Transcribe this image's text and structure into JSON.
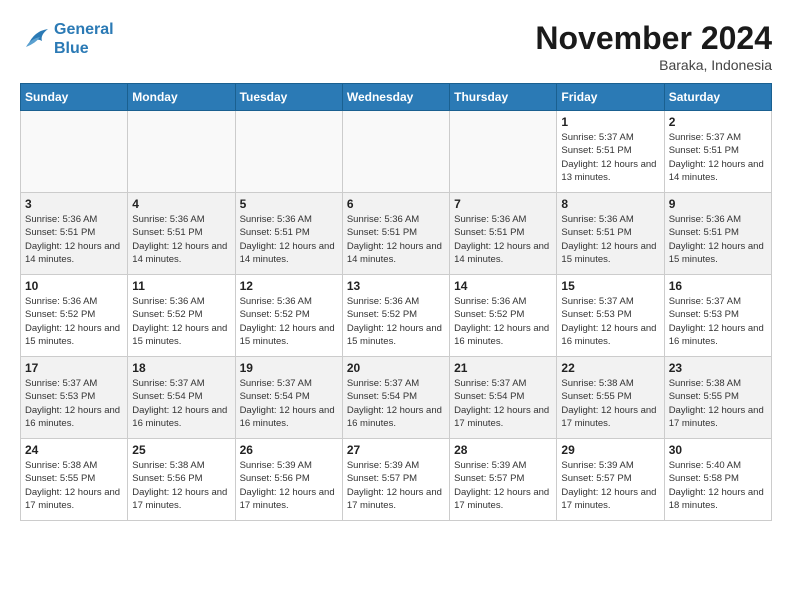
{
  "logo": {
    "line1": "General",
    "line2": "Blue"
  },
  "title": "November 2024",
  "location": "Baraka, Indonesia",
  "weekdays": [
    "Sunday",
    "Monday",
    "Tuesday",
    "Wednesday",
    "Thursday",
    "Friday",
    "Saturday"
  ],
  "weeks": [
    [
      {
        "day": "",
        "sunrise": "",
        "sunset": "",
        "daylight": ""
      },
      {
        "day": "",
        "sunrise": "",
        "sunset": "",
        "daylight": ""
      },
      {
        "day": "",
        "sunrise": "",
        "sunset": "",
        "daylight": ""
      },
      {
        "day": "",
        "sunrise": "",
        "sunset": "",
        "daylight": ""
      },
      {
        "day": "",
        "sunrise": "",
        "sunset": "",
        "daylight": ""
      },
      {
        "day": "1",
        "sunrise": "Sunrise: 5:37 AM",
        "sunset": "Sunset: 5:51 PM",
        "daylight": "Daylight: 12 hours and 13 minutes."
      },
      {
        "day": "2",
        "sunrise": "Sunrise: 5:37 AM",
        "sunset": "Sunset: 5:51 PM",
        "daylight": "Daylight: 12 hours and 14 minutes."
      }
    ],
    [
      {
        "day": "3",
        "sunrise": "Sunrise: 5:36 AM",
        "sunset": "Sunset: 5:51 PM",
        "daylight": "Daylight: 12 hours and 14 minutes."
      },
      {
        "day": "4",
        "sunrise": "Sunrise: 5:36 AM",
        "sunset": "Sunset: 5:51 PM",
        "daylight": "Daylight: 12 hours and 14 minutes."
      },
      {
        "day": "5",
        "sunrise": "Sunrise: 5:36 AM",
        "sunset": "Sunset: 5:51 PM",
        "daylight": "Daylight: 12 hours and 14 minutes."
      },
      {
        "day": "6",
        "sunrise": "Sunrise: 5:36 AM",
        "sunset": "Sunset: 5:51 PM",
        "daylight": "Daylight: 12 hours and 14 minutes."
      },
      {
        "day": "7",
        "sunrise": "Sunrise: 5:36 AM",
        "sunset": "Sunset: 5:51 PM",
        "daylight": "Daylight: 12 hours and 14 minutes."
      },
      {
        "day": "8",
        "sunrise": "Sunrise: 5:36 AM",
        "sunset": "Sunset: 5:51 PM",
        "daylight": "Daylight: 12 hours and 15 minutes."
      },
      {
        "day": "9",
        "sunrise": "Sunrise: 5:36 AM",
        "sunset": "Sunset: 5:51 PM",
        "daylight": "Daylight: 12 hours and 15 minutes."
      }
    ],
    [
      {
        "day": "10",
        "sunrise": "Sunrise: 5:36 AM",
        "sunset": "Sunset: 5:52 PM",
        "daylight": "Daylight: 12 hours and 15 minutes."
      },
      {
        "day": "11",
        "sunrise": "Sunrise: 5:36 AM",
        "sunset": "Sunset: 5:52 PM",
        "daylight": "Daylight: 12 hours and 15 minutes."
      },
      {
        "day": "12",
        "sunrise": "Sunrise: 5:36 AM",
        "sunset": "Sunset: 5:52 PM",
        "daylight": "Daylight: 12 hours and 15 minutes."
      },
      {
        "day": "13",
        "sunrise": "Sunrise: 5:36 AM",
        "sunset": "Sunset: 5:52 PM",
        "daylight": "Daylight: 12 hours and 15 minutes."
      },
      {
        "day": "14",
        "sunrise": "Sunrise: 5:36 AM",
        "sunset": "Sunset: 5:52 PM",
        "daylight": "Daylight: 12 hours and 16 minutes."
      },
      {
        "day": "15",
        "sunrise": "Sunrise: 5:37 AM",
        "sunset": "Sunset: 5:53 PM",
        "daylight": "Daylight: 12 hours and 16 minutes."
      },
      {
        "day": "16",
        "sunrise": "Sunrise: 5:37 AM",
        "sunset": "Sunset: 5:53 PM",
        "daylight": "Daylight: 12 hours and 16 minutes."
      }
    ],
    [
      {
        "day": "17",
        "sunrise": "Sunrise: 5:37 AM",
        "sunset": "Sunset: 5:53 PM",
        "daylight": "Daylight: 12 hours and 16 minutes."
      },
      {
        "day": "18",
        "sunrise": "Sunrise: 5:37 AM",
        "sunset": "Sunset: 5:54 PM",
        "daylight": "Daylight: 12 hours and 16 minutes."
      },
      {
        "day": "19",
        "sunrise": "Sunrise: 5:37 AM",
        "sunset": "Sunset: 5:54 PM",
        "daylight": "Daylight: 12 hours and 16 minutes."
      },
      {
        "day": "20",
        "sunrise": "Sunrise: 5:37 AM",
        "sunset": "Sunset: 5:54 PM",
        "daylight": "Daylight: 12 hours and 16 minutes."
      },
      {
        "day": "21",
        "sunrise": "Sunrise: 5:37 AM",
        "sunset": "Sunset: 5:54 PM",
        "daylight": "Daylight: 12 hours and 17 minutes."
      },
      {
        "day": "22",
        "sunrise": "Sunrise: 5:38 AM",
        "sunset": "Sunset: 5:55 PM",
        "daylight": "Daylight: 12 hours and 17 minutes."
      },
      {
        "day": "23",
        "sunrise": "Sunrise: 5:38 AM",
        "sunset": "Sunset: 5:55 PM",
        "daylight": "Daylight: 12 hours and 17 minutes."
      }
    ],
    [
      {
        "day": "24",
        "sunrise": "Sunrise: 5:38 AM",
        "sunset": "Sunset: 5:55 PM",
        "daylight": "Daylight: 12 hours and 17 minutes."
      },
      {
        "day": "25",
        "sunrise": "Sunrise: 5:38 AM",
        "sunset": "Sunset: 5:56 PM",
        "daylight": "Daylight: 12 hours and 17 minutes."
      },
      {
        "day": "26",
        "sunrise": "Sunrise: 5:39 AM",
        "sunset": "Sunset: 5:56 PM",
        "daylight": "Daylight: 12 hours and 17 minutes."
      },
      {
        "day": "27",
        "sunrise": "Sunrise: 5:39 AM",
        "sunset": "Sunset: 5:57 PM",
        "daylight": "Daylight: 12 hours and 17 minutes."
      },
      {
        "day": "28",
        "sunrise": "Sunrise: 5:39 AM",
        "sunset": "Sunset: 5:57 PM",
        "daylight": "Daylight: 12 hours and 17 minutes."
      },
      {
        "day": "29",
        "sunrise": "Sunrise: 5:39 AM",
        "sunset": "Sunset: 5:57 PM",
        "daylight": "Daylight: 12 hours and 17 minutes."
      },
      {
        "day": "30",
        "sunrise": "Sunrise: 5:40 AM",
        "sunset": "Sunset: 5:58 PM",
        "daylight": "Daylight: 12 hours and 18 minutes."
      }
    ]
  ]
}
